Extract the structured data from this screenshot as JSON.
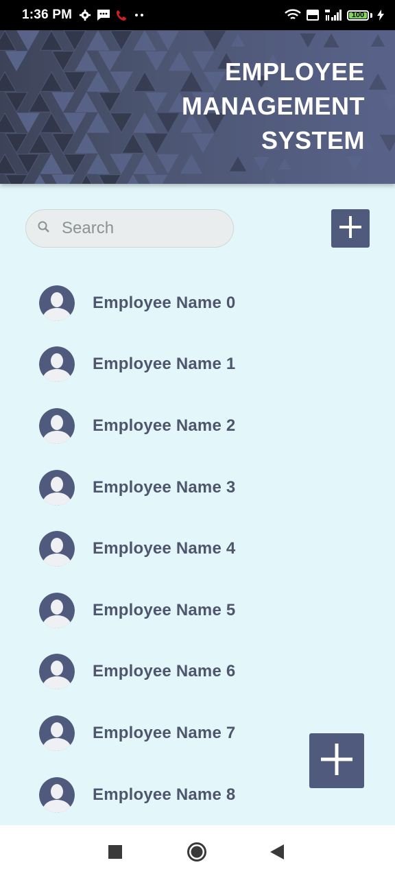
{
  "status_bar": {
    "time": "1:36 PM",
    "battery": "100"
  },
  "header": {
    "title_lines": [
      "EMPLOYEE",
      "MANAGEMENT",
      "SYSTEM"
    ]
  },
  "search": {
    "placeholder": "Search"
  },
  "employees": [
    {
      "name": "Employee Name 0"
    },
    {
      "name": "Employee Name 1"
    },
    {
      "name": "Employee Name 2"
    },
    {
      "name": "Employee Name 3"
    },
    {
      "name": "Employee Name 4"
    },
    {
      "name": "Employee Name 5"
    },
    {
      "name": "Employee Name 6"
    },
    {
      "name": "Employee Name 7"
    },
    {
      "name": "Employee Name 8"
    }
  ],
  "icons": {
    "add_top": "plus-icon",
    "fab": "plus-icon",
    "search": "search-icon",
    "avatar": "person-icon",
    "nav_recents": "square-icon",
    "nav_home": "circle-icon",
    "nav_back": "triangle-back-icon"
  },
  "colors": {
    "accent": "#505a7d",
    "background": "#e3f7fb",
    "text": "#4e556c"
  }
}
